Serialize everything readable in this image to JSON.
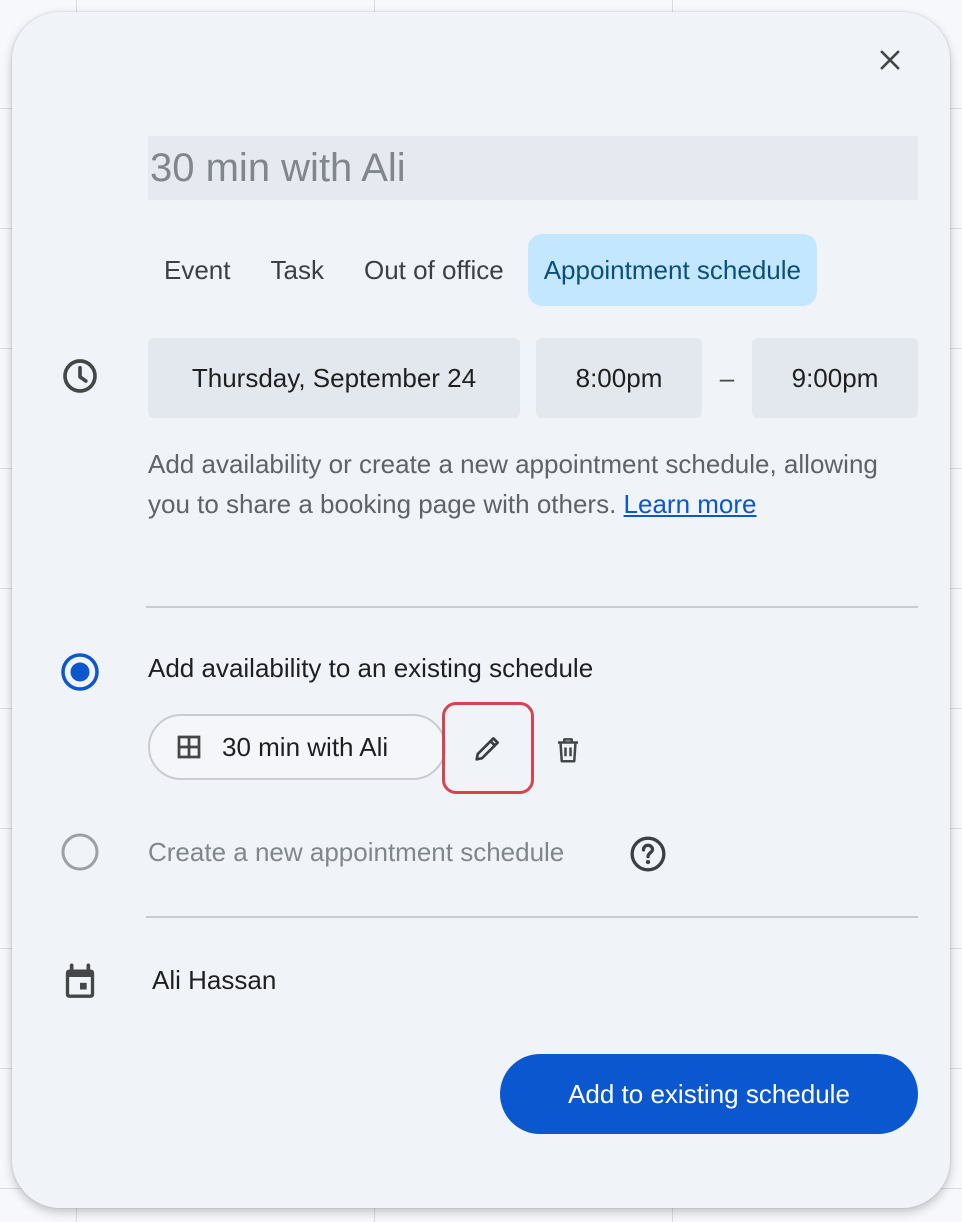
{
  "title_input": {
    "value": "30 min with Ali"
  },
  "tabs": [
    {
      "label": "Event"
    },
    {
      "label": "Task"
    },
    {
      "label": "Out of office"
    },
    {
      "label": "Appointment schedule"
    }
  ],
  "datetime": {
    "date": "Thursday, September 24",
    "start": "8:00pm",
    "separator": "–",
    "end": "9:00pm"
  },
  "description": {
    "text": "Add availability or create a new appointment schedule, allowing you to share a booking page with others.",
    "link": "Learn more"
  },
  "options": {
    "existing_label": "Add availability to an existing schedule",
    "existing_selected": true,
    "new_label": "Create a new appointment schedule",
    "new_selected": false
  },
  "schedule_chip": {
    "label": "30 min with Ali"
  },
  "calendar": {
    "owner": "Ali Hassan"
  },
  "primary_button": {
    "label": "Add to existing schedule"
  },
  "icons": {
    "close": "close-icon",
    "clock": "clock-icon",
    "grid": "grid-icon",
    "edit": "pencil-icon",
    "delete": "trash-icon",
    "help": "help-icon",
    "calendar": "calendar-icon"
  },
  "colors": {
    "accent": "#0b57d0",
    "active_tab": "#c2e7ff",
    "highlight_border": "#d9434f"
  }
}
